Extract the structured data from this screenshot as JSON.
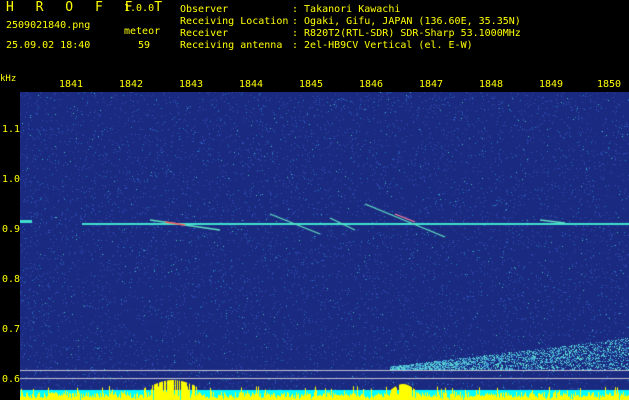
{
  "header": {
    "app_title": "H R O F F T",
    "app_version": "1.0.0",
    "filename": "2509021840.png",
    "datetime": "25.09.02 18:40",
    "meteor_label": "meteor",
    "meteor_count": "59"
  },
  "info": [
    {
      "key": "Observer",
      "value": ": Takanori Kawachi"
    },
    {
      "key": "Receiving Location",
      "value": ": Ogaki, Gifu, JAPAN (136.60E, 35.35N)"
    },
    {
      "key": "Receiver",
      "value": ": R820T2(RTL-SDR) SDR-Sharp 53.1000MHz"
    },
    {
      "key": "Receiving antenna",
      "value": ": 2el-HB9CV Vertical (el. E-W)"
    }
  ],
  "axis": {
    "y_unit": "kHz",
    "y_ticks": [
      "1.1",
      "1.0",
      "0.9",
      "0.8",
      "0.7",
      "0.6"
    ],
    "x_ticks": [
      "1841",
      "1842",
      "1843",
      "1844",
      "1845",
      "1846",
      "1847",
      "1848",
      "1849",
      "1850"
    ]
  },
  "colors": {
    "background": "#1a2a80",
    "text": "#ffff00",
    "carrier": "#40e0d0",
    "power_bar": "#ffff00",
    "baseline": "#00ffff"
  }
}
